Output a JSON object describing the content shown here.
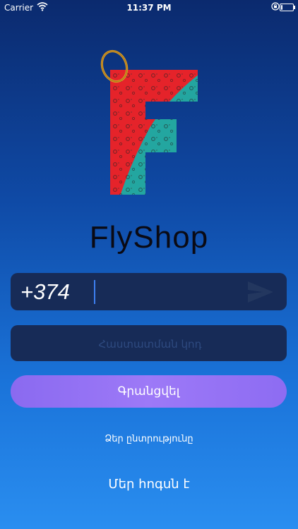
{
  "status_bar": {
    "carrier": "Carrier",
    "time": "11:37 PM",
    "wifi_icon": "wifi-icon",
    "lock_icon": "orientation-lock-icon",
    "battery_icon": "battery-icon",
    "battery_level": 0.15
  },
  "logo": {
    "icon": "flyshop-logo-icon",
    "colors": {
      "red": "#e5232a",
      "teal": "#23a6a0",
      "ring": "#d69b26"
    }
  },
  "brand": {
    "name": "FlyShop"
  },
  "phone": {
    "value": "+374",
    "send_icon": "send-arrow-icon"
  },
  "verification": {
    "placeholder": "Հաստատման կոդ",
    "value": ""
  },
  "register": {
    "label": "Գրանցվել"
  },
  "links": {
    "choice": "Ձեր ընտրությունը",
    "care": "Մեր հոգսն է"
  },
  "colors": {
    "field_bg": "#172b57",
    "button_accent": "#9575f5",
    "caret": "#3d7ff0"
  }
}
